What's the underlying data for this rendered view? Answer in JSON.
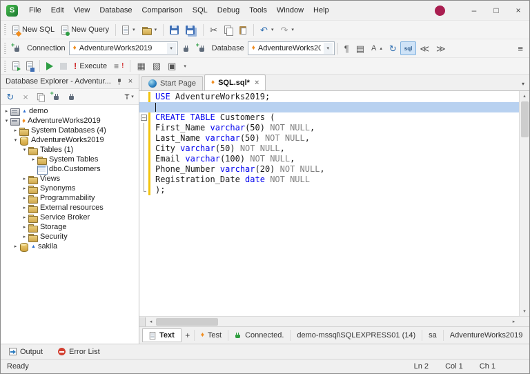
{
  "colors": {
    "keyword": "#0000ee",
    "comment_gray": "#808080",
    "current_line": "#b8d1f0",
    "change_bar": "#f2c40f",
    "category_orange": "#f08c1e",
    "connected_green": "#2f9e3f"
  },
  "icons": {
    "dropdown": "▾",
    "collapsed_arrow": "▸",
    "expanded_arrow": "▾",
    "up_arrow": "▴",
    "down_arrow": "▾",
    "left_arrow": "◂",
    "right_arrow": "▸",
    "diamond": "♦",
    "scissors": "✂",
    "undo": "↶",
    "redo": "↷",
    "refresh": "↻",
    "close": "×",
    "minimize": "–",
    "maximize": "□",
    "plus": "+",
    "exclaim": "!",
    "menu_lines": "≡",
    "triangle_badge": "▲",
    "fold_minus": "–",
    "grid": "▦",
    "plan": "▧",
    "rows": "▤",
    "window_box": "▣",
    "pilcrow": "¶",
    "indent_left": "≪",
    "indent_right": "≫",
    "uppercase": "A"
  },
  "titlebar": {
    "logo": "S",
    "menus": [
      "File",
      "Edit",
      "View",
      "Database",
      "Comparison",
      "SQL",
      "Debug",
      "Tools",
      "Window",
      "Help"
    ]
  },
  "toolbar1": {
    "new_sql": "New SQL",
    "new_query": "New Query"
  },
  "toolbar2": {
    "connection_label": "Connection",
    "connection_value": "AdventureWorks2019",
    "database_label": "Database",
    "database_value": "AdventureWorks20...",
    "sql_toggle": "sql"
  },
  "toolbar3": {
    "execute": "Execute"
  },
  "explorer": {
    "title": "Database Explorer - Adventur...",
    "tree": [
      {
        "label": "demo",
        "level": 0,
        "expand": "collapsed",
        "icon": "server",
        "badge": "blue-triangle"
      },
      {
        "label": "AdventureWorks2019",
        "level": 0,
        "expand": "expanded",
        "icon": "server",
        "badge": "orange-diamond"
      },
      {
        "label": "System Databases (4)",
        "level": 1,
        "expand": "collapsed",
        "icon": "folder"
      },
      {
        "label": "AdventureWorks2019",
        "level": 1,
        "expand": "expanded",
        "icon": "database"
      },
      {
        "label": "Tables (1)",
        "level": 2,
        "expand": "expanded",
        "icon": "folder"
      },
      {
        "label": "System Tables",
        "level": 3,
        "expand": "collapsed",
        "icon": "folder"
      },
      {
        "label": "dbo.Customers",
        "level": 3,
        "expand": "leaf",
        "icon": "table"
      },
      {
        "label": "Views",
        "level": 2,
        "expand": "collapsed",
        "icon": "folder"
      },
      {
        "label": "Synonyms",
        "level": 2,
        "expand": "collapsed",
        "icon": "folder"
      },
      {
        "label": "Programmability",
        "level": 2,
        "expand": "collapsed",
        "icon": "folder"
      },
      {
        "label": "External resources",
        "level": 2,
        "expand": "collapsed",
        "icon": "folder"
      },
      {
        "label": "Service Broker",
        "level": 2,
        "expand": "collapsed",
        "icon": "folder"
      },
      {
        "label": "Storage",
        "level": 2,
        "expand": "collapsed",
        "icon": "folder"
      },
      {
        "label": "Security",
        "level": 2,
        "expand": "collapsed",
        "icon": "folder"
      },
      {
        "label": "sakila",
        "level": 1,
        "expand": "collapsed",
        "icon": "database",
        "badge": "blue-triangle"
      }
    ]
  },
  "tabs": [
    {
      "label": "Start Page"
    },
    {
      "label": "SQL.sql*"
    }
  ],
  "editor": {
    "lines": [
      {
        "changed": true,
        "tokens": [
          {
            "t": "USE",
            "c": "kw"
          },
          {
            "t": " AdventureWorks2019;",
            "c": "pl"
          }
        ]
      },
      {
        "current": true,
        "tokens": []
      },
      {
        "changed": true,
        "fold": "start",
        "tokens": [
          {
            "t": "CREATE TABLE",
            "c": "kw"
          },
          {
            "t": " Customers (",
            "c": "pl"
          }
        ]
      },
      {
        "changed": true,
        "fold": "mid",
        "tokens": [
          {
            "t": "First_Name ",
            "c": "pl"
          },
          {
            "t": "varchar",
            "c": "kw"
          },
          {
            "t": "(50) ",
            "c": "pl"
          },
          {
            "t": "NOT NULL",
            "c": "cm"
          },
          {
            "t": ",",
            "c": "pl"
          }
        ]
      },
      {
        "changed": true,
        "fold": "mid",
        "tokens": [
          {
            "t": "Last_Name ",
            "c": "pl"
          },
          {
            "t": "varchar",
            "c": "kw"
          },
          {
            "t": "(50) ",
            "c": "pl"
          },
          {
            "t": "NOT NULL",
            "c": "cm"
          },
          {
            "t": ",",
            "c": "pl"
          }
        ]
      },
      {
        "changed": true,
        "fold": "mid",
        "tokens": [
          {
            "t": "City ",
            "c": "pl"
          },
          {
            "t": "varchar",
            "c": "kw"
          },
          {
            "t": "(50) ",
            "c": "pl"
          },
          {
            "t": "NOT NULL",
            "c": "cm"
          },
          {
            "t": ",",
            "c": "pl"
          }
        ]
      },
      {
        "changed": true,
        "fold": "mid",
        "tokens": [
          {
            "t": "Email ",
            "c": "pl"
          },
          {
            "t": "varchar",
            "c": "kw"
          },
          {
            "t": "(100) ",
            "c": "pl"
          },
          {
            "t": "NOT NULL",
            "c": "cm"
          },
          {
            "t": ",",
            "c": "pl"
          }
        ]
      },
      {
        "changed": true,
        "fold": "mid",
        "tokens": [
          {
            "t": "Phone_Number ",
            "c": "pl"
          },
          {
            "t": "varchar",
            "c": "kw"
          },
          {
            "t": "(20) ",
            "c": "pl"
          },
          {
            "t": "NOT NULL",
            "c": "cm"
          },
          {
            "t": ",",
            "c": "pl"
          }
        ]
      },
      {
        "changed": true,
        "fold": "mid",
        "tokens": [
          {
            "t": "Registration_Date ",
            "c": "pl"
          },
          {
            "t": "date",
            "c": "kw"
          },
          {
            "t": " ",
            "c": "pl"
          },
          {
            "t": "NOT NULL",
            "c": "cm"
          }
        ]
      },
      {
        "changed": true,
        "fold": "end",
        "tokens": [
          {
            "t": ");",
            "c": "pl"
          }
        ]
      }
    ]
  },
  "docbar": {
    "text_tab": "Text",
    "add": "+",
    "category": "Test",
    "connected": "Connected.",
    "server": "demo-mssql\\SQLEXPRESS01 (14)",
    "user": "sa",
    "database": "AdventureWorks2019"
  },
  "bottom_tabs": {
    "output": "Output",
    "error_list": "Error List"
  },
  "statusbar": {
    "ready": "Ready",
    "ln": "Ln 2",
    "col": "Col 1",
    "ch": "Ch 1"
  }
}
